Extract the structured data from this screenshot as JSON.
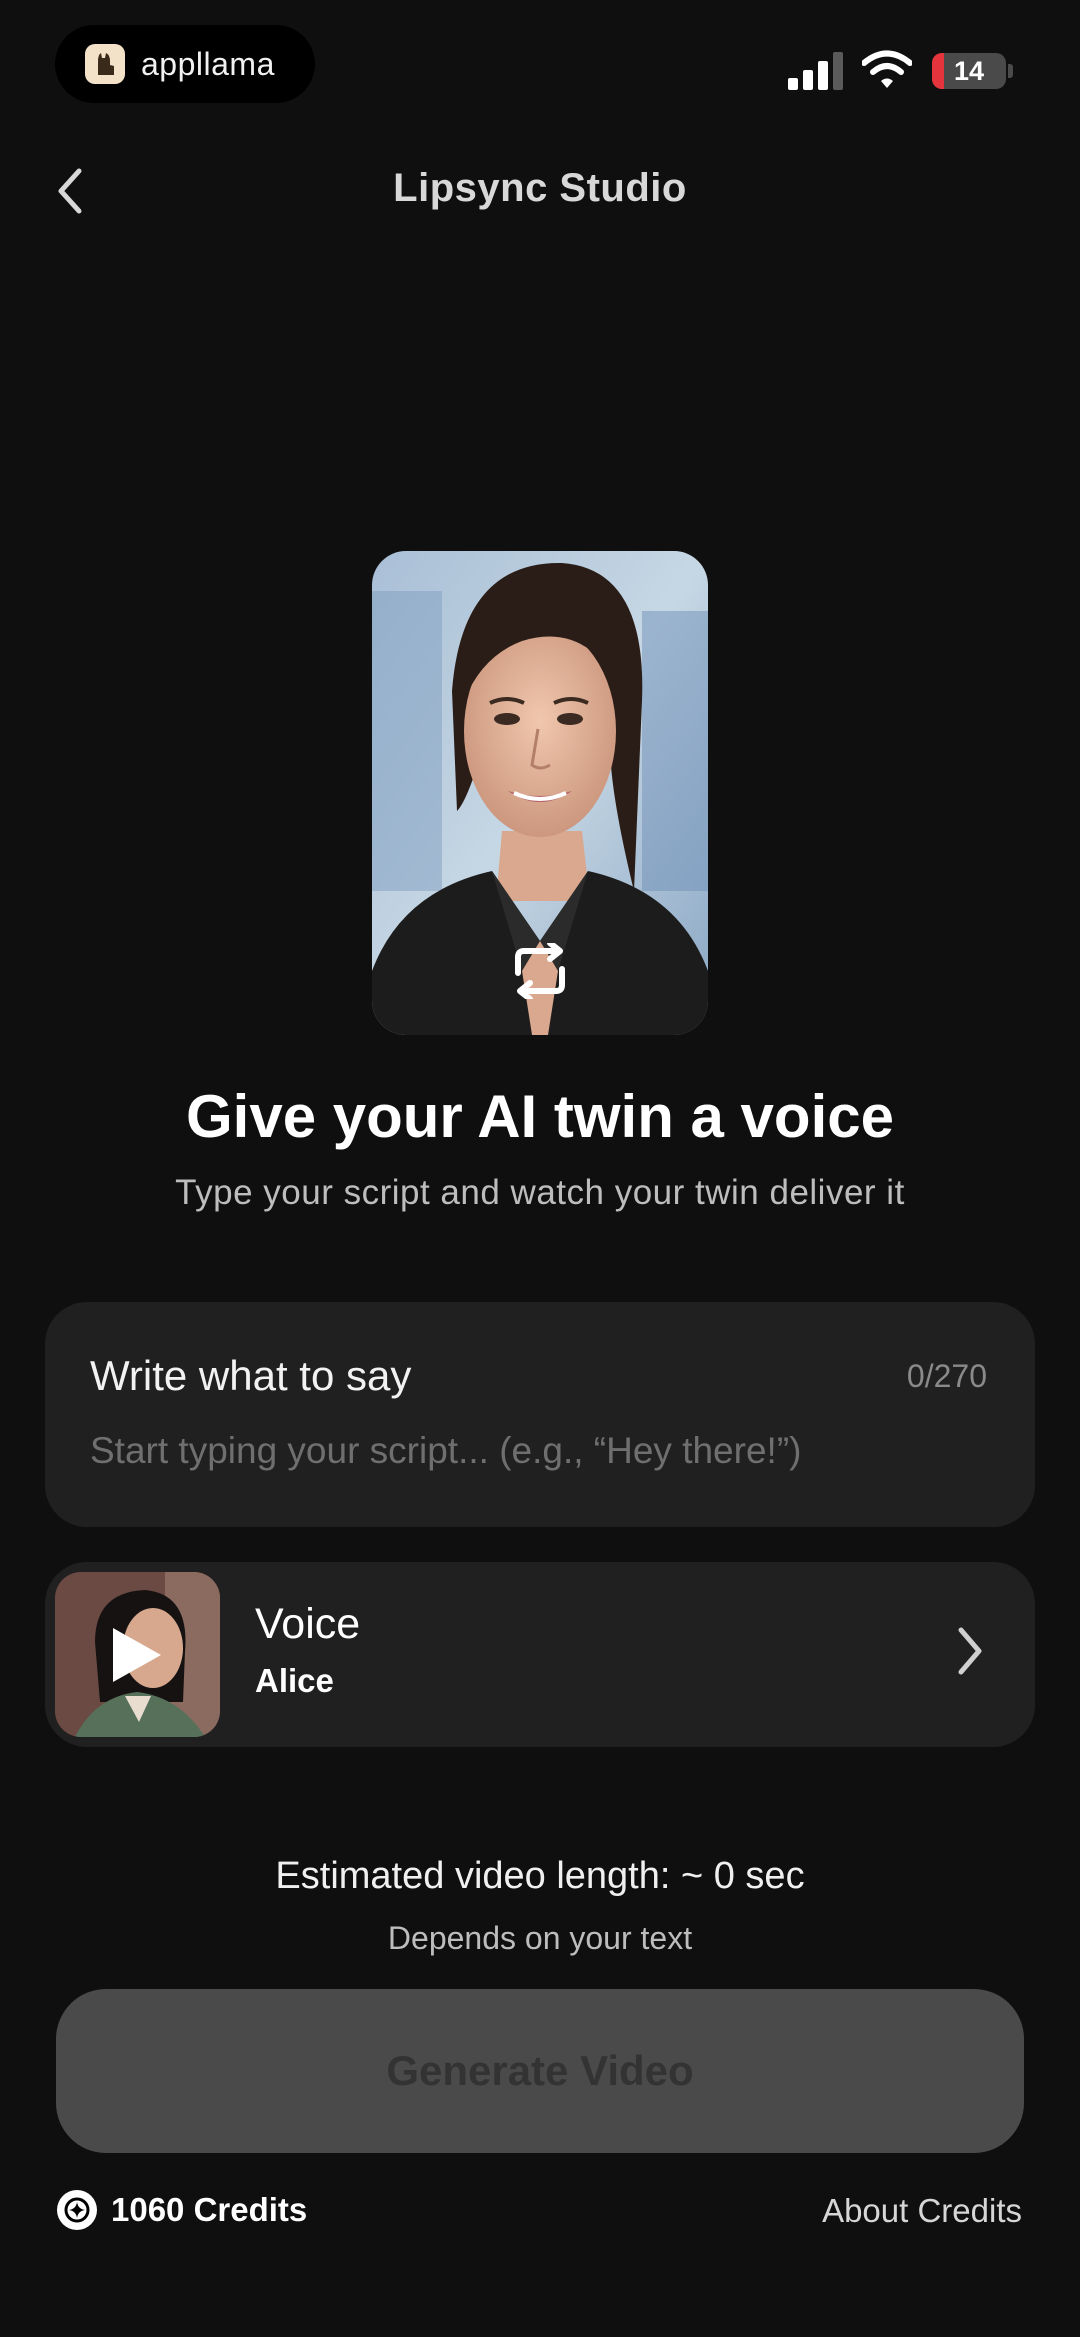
{
  "status_bar": {
    "brand_name": "appllama",
    "battery_level": "14"
  },
  "header": {
    "title": "Lipsync Studio",
    "back_icon": "chevron-left-icon"
  },
  "hero": {
    "headline": "Give your AI twin a voice",
    "subheadline": "Type your script and watch your twin deliver it",
    "swap_icon": "repeat-icon"
  },
  "script": {
    "label": "Write what to say",
    "counter": "0/270",
    "placeholder": "Start typing your script... (e.g., “Hey there!”)",
    "value": ""
  },
  "voice": {
    "label": "Voice",
    "name": "Alice",
    "play_icon": "play-icon",
    "chevron_icon": "chevron-right-icon"
  },
  "estimate": {
    "text": "Estimated video length:  ~ 0 sec",
    "subtext": "Depends on your text"
  },
  "actions": {
    "generate_label": "Generate Video"
  },
  "credits": {
    "text": "1060 Credits",
    "about_label": "About Credits"
  },
  "colors": {
    "background": "#0f0f0f",
    "card": "#202020",
    "button_disabled": "#4a4a4a",
    "battery_low": "#e5343b"
  }
}
